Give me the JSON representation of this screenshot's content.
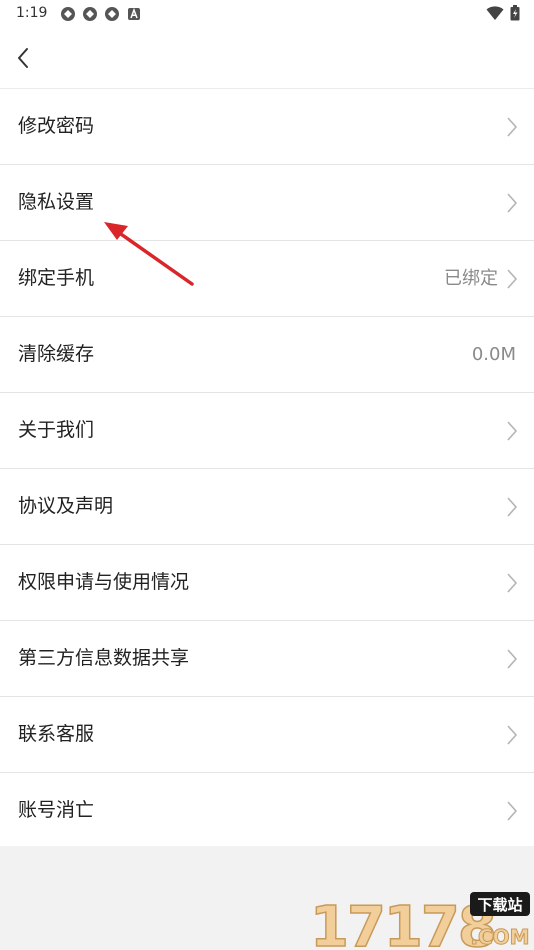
{
  "status_bar": {
    "time": "1:19",
    "notification_icons": [
      "app-icon",
      "app-icon",
      "app-icon",
      "a-icon"
    ],
    "right_icons": [
      "wifi-icon",
      "battery-icon"
    ]
  },
  "header": {
    "back_icon": "chevron-left-icon"
  },
  "settings": {
    "items": [
      {
        "label": "修改密码",
        "value": "",
        "chevron": true
      },
      {
        "label": "隐私设置",
        "value": "",
        "chevron": true
      },
      {
        "label": "绑定手机",
        "value": "已绑定",
        "chevron": true
      },
      {
        "label": "清除缓存",
        "value": "0.0M",
        "chevron": false
      },
      {
        "label": "关于我们",
        "value": "",
        "chevron": true
      },
      {
        "label": "协议及声明",
        "value": "",
        "chevron": true
      },
      {
        "label": "权限申请与使用情况",
        "value": "",
        "chevron": true
      },
      {
        "label": "第三方信息数据共享",
        "value": "",
        "chevron": true
      },
      {
        "label": "联系客服",
        "value": "",
        "chevron": true
      },
      {
        "label": "账号消亡",
        "value": "",
        "chevron": true
      }
    ]
  },
  "annotation": {
    "color": "#d9262b",
    "target": "隐私设置"
  },
  "watermark": {
    "numbers": "17178",
    "badge": "下载站",
    "domain": ".COM",
    "colors": {
      "numbers": "#f2cf9a",
      "badge_bg": "#1a1a1a",
      "domain": "#f2cf9a"
    }
  }
}
